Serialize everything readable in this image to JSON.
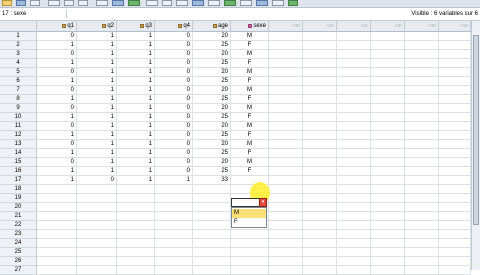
{
  "toolbar": {
    "icons": [
      "open-icon",
      "save-icon",
      "print-icon",
      "dialog-recall-icon",
      "undo-icon",
      "redo-icon",
      "goto-case-icon",
      "goto-variable-icon",
      "variables-icon",
      "find-icon",
      "insert-cases-icon",
      "insert-variable-icon",
      "split-file-icon",
      "weight-cases-icon",
      "select-cases-icon",
      "value-labels-icon",
      "use-sets-icon",
      "show-all-icon",
      "spelling-icon"
    ]
  },
  "cell_editor": {
    "reference": "17 : sexe",
    "value": ""
  },
  "status": {
    "visible_variables": "Visible : 6 variables sur 6"
  },
  "grid": {
    "corner": "",
    "columns": [
      {
        "name": "q1",
        "type": "scale"
      },
      {
        "name": "q2",
        "type": "scale"
      },
      {
        "name": "q3",
        "type": "scale"
      },
      {
        "name": "q4",
        "type": "scale"
      },
      {
        "name": "age",
        "type": "scale"
      },
      {
        "name": "sexe",
        "type": "nominal"
      }
    ],
    "empty_columns": [
      "var",
      "var",
      "var",
      "var",
      "var",
      "var"
    ],
    "rows": [
      {
        "n": "1",
        "q1": "0",
        "q2": "1",
        "q3": "1",
        "q4": "0",
        "age": "20",
        "sexe": "M"
      },
      {
        "n": "2",
        "q1": "1",
        "q2": "1",
        "q3": "1",
        "q4": "0",
        "age": "25",
        "sexe": "F"
      },
      {
        "n": "3",
        "q1": "0",
        "q2": "1",
        "q3": "1",
        "q4": "0",
        "age": "20",
        "sexe": "M"
      },
      {
        "n": "4",
        "q1": "1",
        "q2": "1",
        "q3": "1",
        "q4": "0",
        "age": "25",
        "sexe": "F"
      },
      {
        "n": "5",
        "q1": "0",
        "q2": "1",
        "q3": "1",
        "q4": "0",
        "age": "20",
        "sexe": "M"
      },
      {
        "n": "6",
        "q1": "1",
        "q2": "1",
        "q3": "1",
        "q4": "0",
        "age": "25",
        "sexe": "F"
      },
      {
        "n": "7",
        "q1": "0",
        "q2": "1",
        "q3": "1",
        "q4": "0",
        "age": "20",
        "sexe": "M"
      },
      {
        "n": "8",
        "q1": "1",
        "q2": "1",
        "q3": "1",
        "q4": "0",
        "age": "25",
        "sexe": "F"
      },
      {
        "n": "9",
        "q1": "0",
        "q2": "1",
        "q3": "1",
        "q4": "0",
        "age": "20",
        "sexe": "M"
      },
      {
        "n": "10",
        "q1": "1",
        "q2": "1",
        "q3": "1",
        "q4": "0",
        "age": "25",
        "sexe": "F"
      },
      {
        "n": "11",
        "q1": "0",
        "q2": "1",
        "q3": "1",
        "q4": "0",
        "age": "20",
        "sexe": "M"
      },
      {
        "n": "12",
        "q1": "1",
        "q2": "1",
        "q3": "1",
        "q4": "0",
        "age": "25",
        "sexe": "F"
      },
      {
        "n": "13",
        "q1": "0",
        "q2": "1",
        "q3": "1",
        "q4": "0",
        "age": "20",
        "sexe": "M"
      },
      {
        "n": "14",
        "q1": "1",
        "q2": "1",
        "q3": "1",
        "q4": "0",
        "age": "25",
        "sexe": "F"
      },
      {
        "n": "15",
        "q1": "0",
        "q2": "1",
        "q3": "1",
        "q4": "0",
        "age": "20",
        "sexe": "M"
      },
      {
        "n": "16",
        "q1": "1",
        "q2": "1",
        "q3": "1",
        "q4": "0",
        "age": "25",
        "sexe": "F"
      },
      {
        "n": "17",
        "q1": "1",
        "q2": "0",
        "q3": "1",
        "q4": "1",
        "age": "33",
        "sexe": ""
      },
      {
        "n": "18"
      },
      {
        "n": "19"
      },
      {
        "n": "20"
      },
      {
        "n": "21"
      },
      {
        "n": "22"
      },
      {
        "n": "23"
      },
      {
        "n": "24"
      },
      {
        "n": "25"
      },
      {
        "n": "26"
      },
      {
        "n": "27"
      }
    ]
  },
  "dropdown": {
    "options": [
      "M",
      "F"
    ],
    "highlighted": "M"
  }
}
